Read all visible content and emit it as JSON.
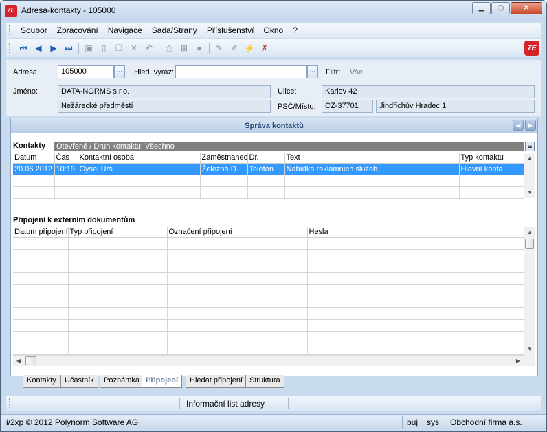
{
  "window": {
    "title": "Adresa-kontakty - 105000",
    "app_icon_text": "7E"
  },
  "menu": [
    "Soubor",
    "Zpracování",
    "Navigace",
    "Sada/Strany",
    "Příslušenství",
    "Okno",
    "?"
  ],
  "form": {
    "adresa_label": "Adresa:",
    "adresa_value": "105000",
    "hled_label": "Hled. výraz:",
    "hled_value": "",
    "filtr_label": "Filtr:",
    "filtr_value": "Vše",
    "jmeno_label": "Jméno:",
    "jmeno_value": "DATA-NORMS s.r.o.",
    "jmeno_value2": "Nežárecké předměstí",
    "ulice_label": "Ulice:",
    "ulice_value": "Karlov 42",
    "psc_label": "PSČ/Místo:",
    "psc_value": "CZ-37701",
    "misto_value": "Jindřichův Hradec 1",
    "dots": "..."
  },
  "panel": {
    "title": "Správa kontaktů"
  },
  "contacts": {
    "title": "Kontakty",
    "filter_text": "Otevřené / Druh kontaktu: Všechno",
    "columns": [
      "Datum",
      "Čas",
      "Kontaktní osoba",
      "Zaměstnanec",
      "Dr.",
      "Text",
      "Typ kontaktu"
    ],
    "rows": [
      [
        "20.06.2012",
        "10:19",
        "Gysel Urs",
        "Železná D.",
        "Telefon",
        "Nabídka reklamních služeb.",
        "Hlavní konta"
      ]
    ]
  },
  "attachments": {
    "title": "Připojení k externím dokumentům",
    "columns": [
      "Datum připojení",
      "Typ připojení",
      "Označení připojení",
      "Hesla"
    ]
  },
  "tabs": [
    "Kontakty",
    "Účastník",
    "Poznámka",
    "Připojení",
    "Hledat připojení",
    "Struktura"
  ],
  "active_tab": "Připojení",
  "infobar": {
    "text": "Informační list adresy"
  },
  "status": {
    "copyright": "i/2xp © 2012 Polynorm Software AG",
    "user1": "buj",
    "user2": "sys",
    "company": "Obchodní firma a.s."
  }
}
